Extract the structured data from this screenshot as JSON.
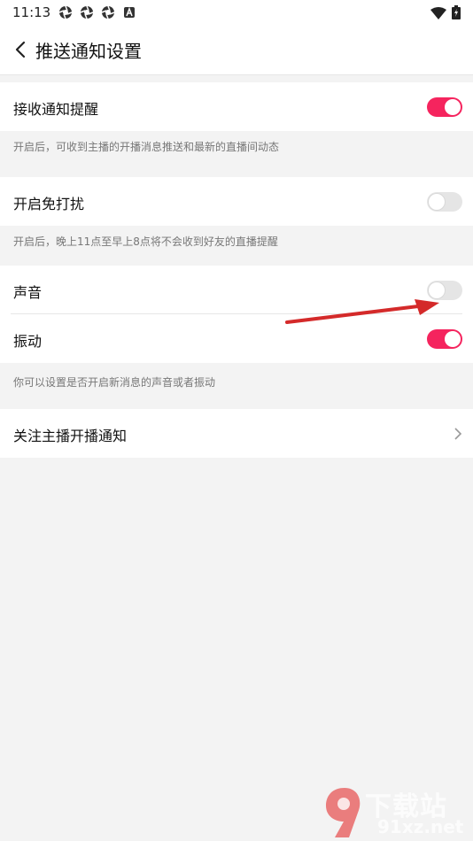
{
  "status": {
    "time": "11:13",
    "icons": [
      "camera-shutter-icon",
      "camera-shutter-icon",
      "camera-shutter-icon",
      "a-badge-icon"
    ],
    "right_icons": [
      "wifi-icon",
      "battery-icon"
    ]
  },
  "header": {
    "title": "推送通知设置",
    "back_icon": "back-arrow-icon"
  },
  "sections": {
    "receive": {
      "label": "接收通知提醒",
      "on": true,
      "hint": "开启后，可收到主播的开播消息推送和最新的直播间动态"
    },
    "dnd": {
      "label": "开启免打扰",
      "on": false,
      "hint": "开启后，晚上11点至早上8点将不会收到好友的直播提醒"
    },
    "sound": {
      "label": "声音",
      "on": false
    },
    "vibrate": {
      "label": "振动",
      "on": true,
      "hint": "你可以设置是否开启新消息的声音或者振动"
    },
    "follow": {
      "label": "关注主播开播通知",
      "chevron_icon": "chevron-right-icon"
    }
  },
  "colors": {
    "accent": "#f5245e",
    "toggle_off": "#e5e5e5",
    "background": "#f3f3f3",
    "annotation_arrow": "#d42a2a"
  },
  "watermark": {
    "text": "下载站",
    "sub": "91xz.net"
  }
}
